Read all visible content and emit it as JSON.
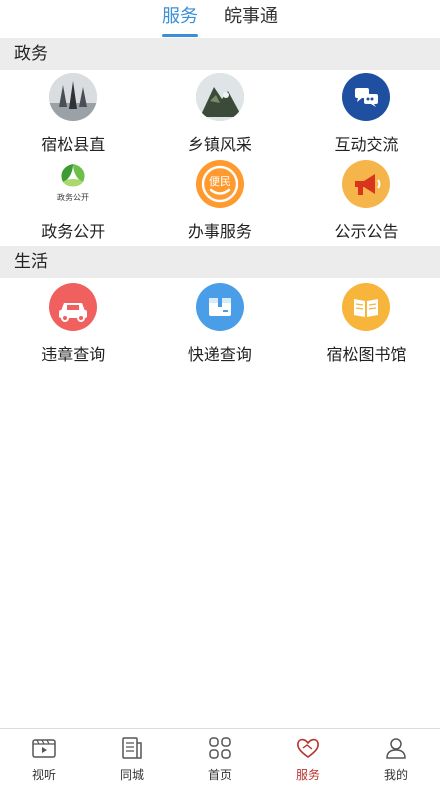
{
  "top_tabs": [
    {
      "label": "服务",
      "active": true
    },
    {
      "label": "皖事通",
      "active": false
    }
  ],
  "sections": {
    "government": {
      "title": "政务",
      "items": [
        {
          "label": "宿松县直",
          "icon": "landmark-photo-icon"
        },
        {
          "label": "乡镇风采",
          "icon": "mountain-photo-icon"
        },
        {
          "label": "互动交流",
          "icon": "chat-bubbles-icon"
        },
        {
          "label": "政务公开",
          "icon": "leaf-logo-icon",
          "icon_caption": "政务公开"
        },
        {
          "label": "办事服务",
          "icon": "convenience-icon",
          "icon_caption": "便民"
        },
        {
          "label": "公示公告",
          "icon": "megaphone-icon"
        }
      ]
    },
    "life": {
      "title": "生活",
      "items": [
        {
          "label": "违章查询",
          "icon": "car-icon"
        },
        {
          "label": "快递查询",
          "icon": "package-icon"
        },
        {
          "label": "宿松图书馆",
          "icon": "book-icon"
        }
      ]
    }
  },
  "bottom_nav": [
    {
      "label": "视听",
      "icon": "video-icon",
      "active": false
    },
    {
      "label": "同城",
      "icon": "news-icon",
      "active": false
    },
    {
      "label": "首页",
      "icon": "home-grid-icon",
      "active": false
    },
    {
      "label": "服务",
      "icon": "heart-hands-icon",
      "active": true
    },
    {
      "label": "我的",
      "icon": "user-icon",
      "active": false
    }
  ],
  "colors": {
    "accent_blue": "#3a8fd6",
    "active_red": "#b8322c",
    "section_bg": "#ececec"
  }
}
